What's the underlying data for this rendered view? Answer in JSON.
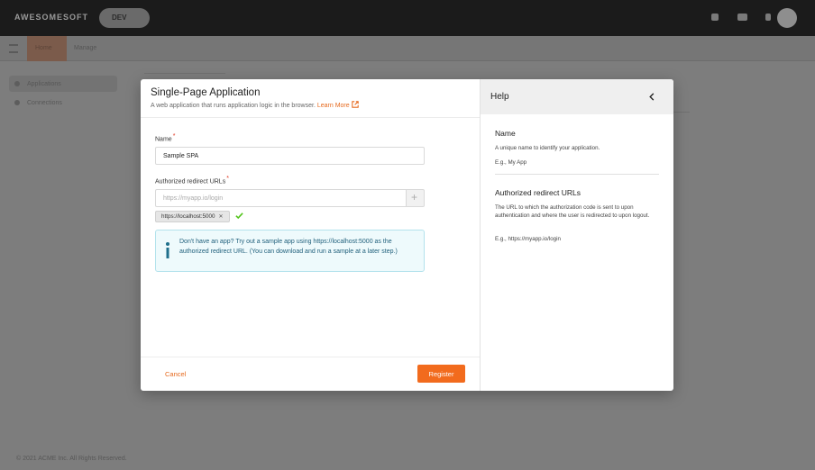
{
  "background": {
    "logo": "AWESOMESOFT",
    "env_badge": "DEV",
    "subnav": {
      "active": "Home",
      "other": "Manage"
    },
    "sidenav": [
      "Applications",
      "Connections"
    ],
    "footer": "© 2021 ACME Inc. All Rights Reserved."
  },
  "modal": {
    "title": "Single-Page Application",
    "subtitle": "A web application that runs application logic in the browser.",
    "learn_more": "Learn More",
    "form": {
      "name_label": "Name",
      "name_value": "Sample SPA",
      "urls_label": "Authorized redirect URLs",
      "url_placeholder": "https://myapp.io/login",
      "add_symbol": "+",
      "url_chips": [
        "https://localhost:5000"
      ],
      "required_mark": "*"
    },
    "info": "Don't have an app? Try out a sample app using https://localhost:5000 as the authorized redirect URL. (You can download and run a sample at a later step.)",
    "cancel_label": "Cancel",
    "register_label": "Register"
  },
  "help": {
    "title": "Help",
    "sections": [
      {
        "title": "Name",
        "text": "A unique name to identify your application.",
        "example": "E.g., My App"
      },
      {
        "title": "Authorized redirect URLs",
        "text": "The URL to which the authorization code is sent to upon authentication and where the user is redirected to upon logout.",
        "example": "E.g., https://myapp.io/login"
      }
    ]
  },
  "colors": {
    "accent": "#f26b1d",
    "link": "#e6691d",
    "info_bg": "#eefafc",
    "info_border": "#b3e2ec",
    "success": "#52c41a"
  },
  "icons": [
    "external-link-icon",
    "info-icon",
    "check-icon",
    "chevron-left-icon",
    "plus-icon",
    "close-icon"
  ]
}
